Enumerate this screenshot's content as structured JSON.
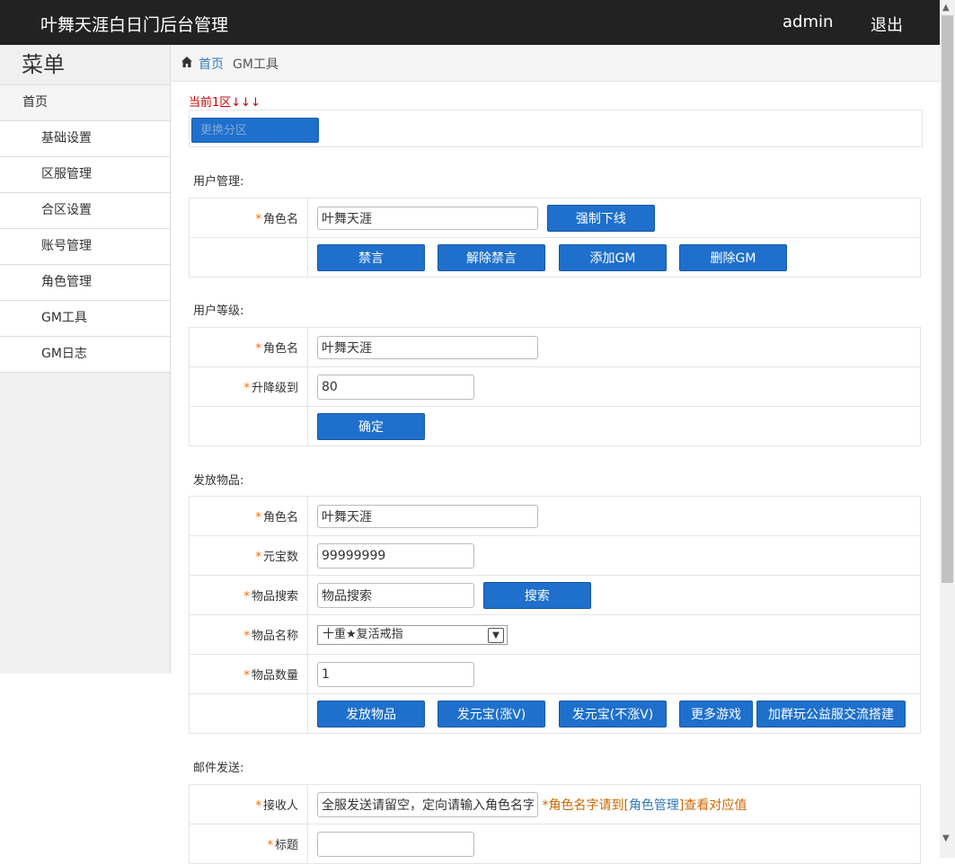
{
  "header": {
    "title": "叶舞天涯白日门后台管理",
    "user": "admin",
    "logout": "退出"
  },
  "sidebar": {
    "title": "菜单",
    "items": [
      {
        "label": "首页"
      },
      {
        "label": "基础设置"
      },
      {
        "label": "区服管理"
      },
      {
        "label": "合区设置"
      },
      {
        "label": "账号管理"
      },
      {
        "label": "角色管理"
      },
      {
        "label": "GM工具"
      },
      {
        "label": "GM日志"
      }
    ]
  },
  "breadcrumb": {
    "home": "首页",
    "current": "GM工具",
    "icon": "home-icon"
  },
  "zone": {
    "note": "当前1区↓↓↓",
    "change_button": "更换分区"
  },
  "required_mark": "*",
  "user_mgmt": {
    "title": "用户管理:",
    "role_label": "角色名",
    "role_value": "叶舞天涯",
    "kick_button": "强制下线",
    "mute_button": "禁言",
    "unmute_button": "解除禁言",
    "add_gm_button": "添加GM",
    "del_gm_button": "删除GM"
  },
  "user_level": {
    "title": "用户等级:",
    "role_label": "角色名",
    "role_value": "叶舞天涯",
    "level_label": "升降级到",
    "level_value": "80",
    "confirm_button": "确定"
  },
  "items": {
    "title": "发放物品:",
    "role_label": "角色名",
    "role_value": "叶舞天涯",
    "gold_label": "元宝数",
    "gold_value": "99999999",
    "search_label": "物品搜索",
    "search_value": "物品搜索",
    "search_button": "搜索",
    "name_label": "物品名称",
    "name_selected": "十重★复活戒指",
    "qty_label": "物品数量",
    "qty_value": "1",
    "send_button": "发放物品",
    "gold_v_button": "发元宝(涨V)",
    "gold_nov_button": "发元宝(不涨V)",
    "more_games_button": "更多游戏",
    "join_group_button": "加群玩公益服交流搭建"
  },
  "mail": {
    "title": "邮件发送:",
    "recipient_label": "接收人",
    "recipient_value": "全服发送请留空，定向请输入角色名字",
    "hint_prefix": "*角色名字请到[",
    "hint_link": "角色管理",
    "hint_suffix": "]查看对应值",
    "subject_label": "标题",
    "subject_value": ""
  }
}
